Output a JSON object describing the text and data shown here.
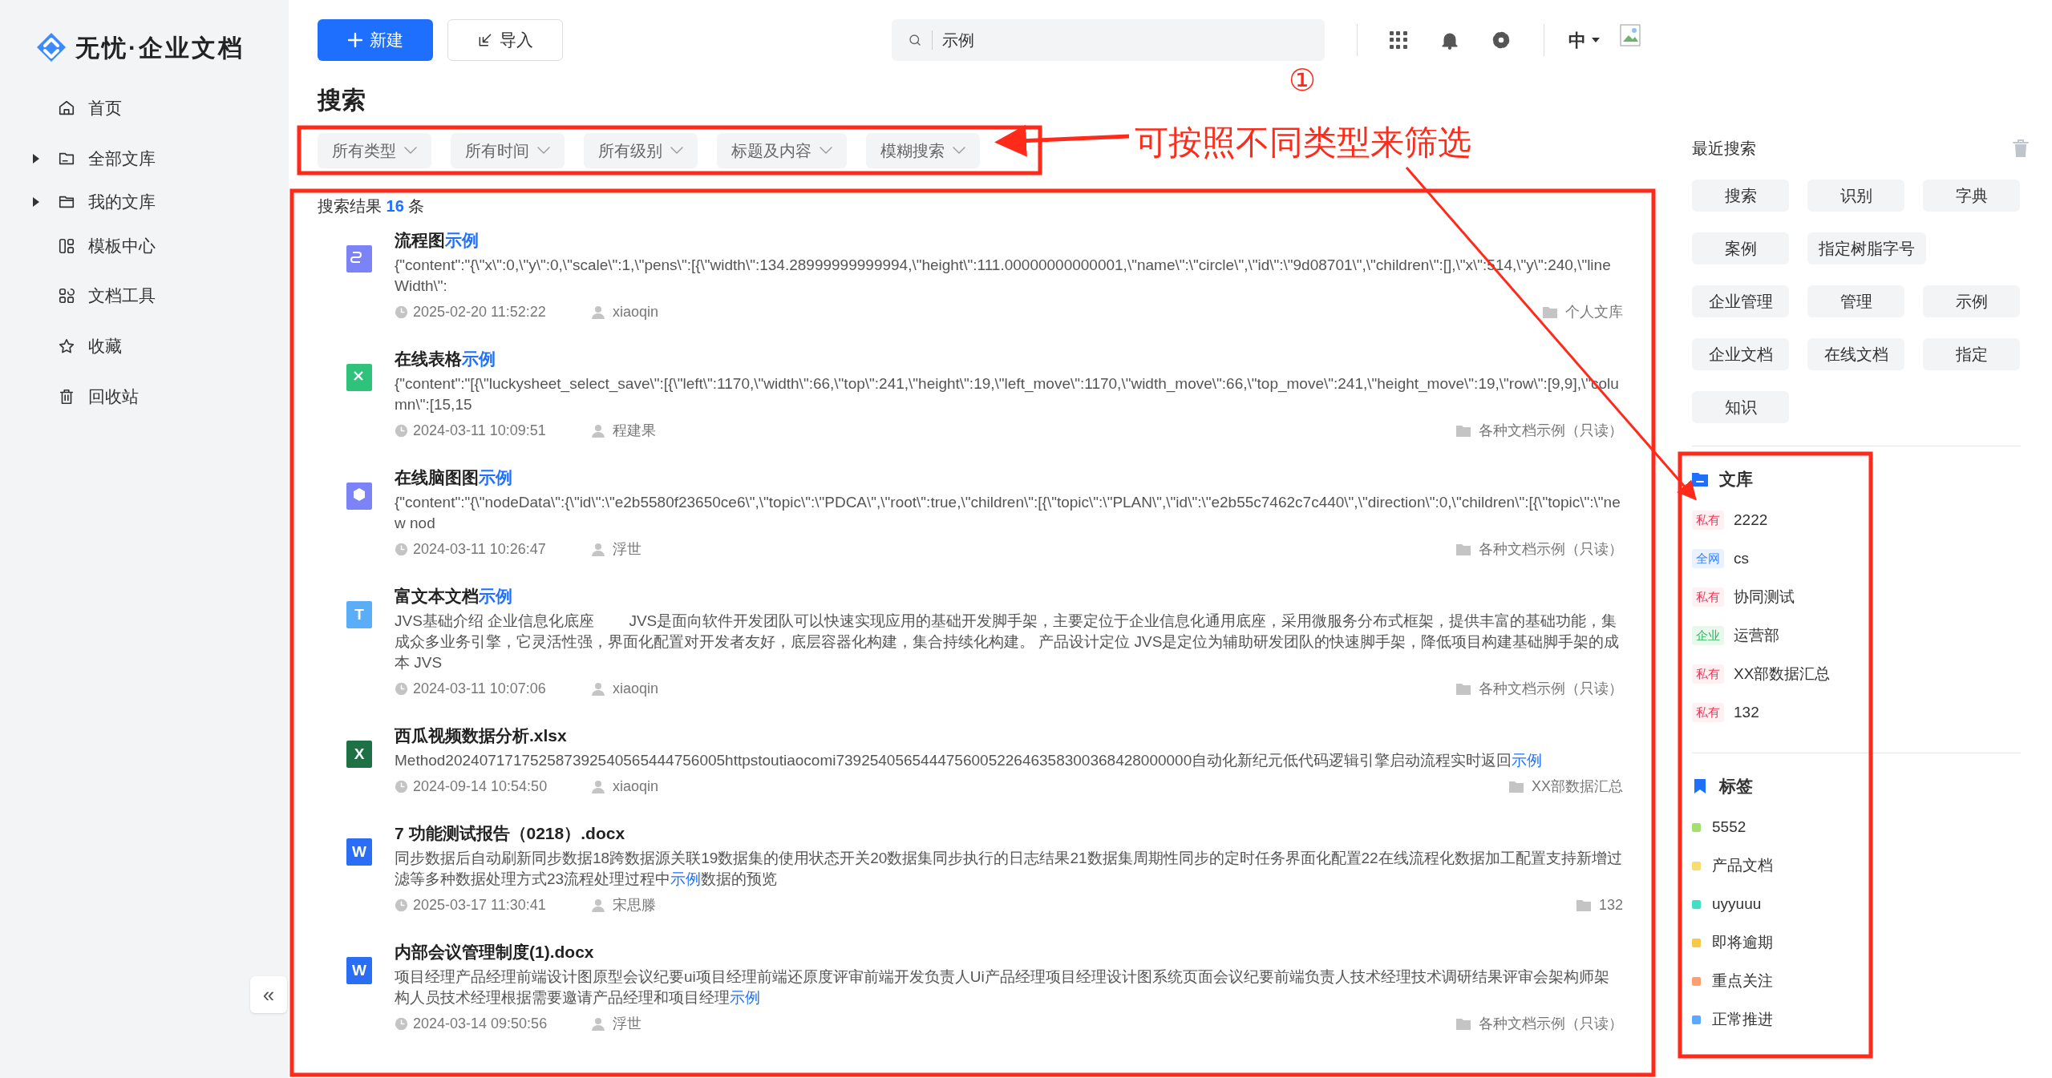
{
  "app": {
    "name": "无忧·企业文档"
  },
  "sidebar": {
    "items": [
      {
        "label": "首页",
        "expandable": false
      },
      {
        "label": "全部文库",
        "expandable": true
      },
      {
        "label": "我的文库",
        "expandable": true
      },
      {
        "label": "模板中心",
        "expandable": false
      },
      {
        "label": "文档工具",
        "expandable": false
      },
      {
        "label": "收藏",
        "expandable": false
      },
      {
        "label": "回收站",
        "expandable": false
      }
    ],
    "collapse": "«"
  },
  "toolbar": {
    "new_button": "新建",
    "import_button": "导入",
    "search": {
      "value": "示例"
    },
    "language": "中"
  },
  "page_title": "搜索",
  "filters": [
    "所有类型",
    "所有时间",
    "所有级别",
    "标题及内容",
    "模糊搜索"
  ],
  "summary": [
    {
      "text": "搜索结果 ",
      "match": false
    },
    {
      "text": "16",
      "match": true
    },
    {
      "text": " 条",
      "match": false
    }
  ],
  "results": [
    {
      "kind": "flow",
      "title": [
        {
          "text": "流程图",
          "match": false
        },
        {
          "text": "示例",
          "match": true
        }
      ],
      "content": [
        {
          "text": "{\"content\":\"{\\\"x\\\":0,\\\"y\\\":0,\\\"scale\\\":1,\\\"pens\\\":[{\\\"width\\\":134.28999999999994,\\\"height\\\":111.00000000000001,\\\"name\\\":\\\"circle\\\",\\\"id\\\":\\\"9d08701\\\",\\\"children\\\":[],\\\"x\\\":514,\\\"y\\\":240,\\\"lineWidth\\\":",
          "match": false
        }
      ],
      "time": "2025-02-20 11:52:22",
      "author": "xiaoqin",
      "library": "个人文库"
    },
    {
      "kind": "sheet",
      "title": [
        {
          "text": "在线表格",
          "match": false
        },
        {
          "text": "示例",
          "match": true
        }
      ],
      "content": [
        {
          "text": "{\"content\":\"[{\\\"luckysheet_select_save\\\":[{\\\"left\\\":1170,\\\"width\\\":66,\\\"top\\\":241,\\\"height\\\":19,\\\"left_move\\\":1170,\\\"width_move\\\":66,\\\"top_move\\\":241,\\\"height_move\\\":19,\\\"row\\\":[9,9],\\\"column\\\":[15,15",
          "match": false
        }
      ],
      "time": "2024-03-11 10:09:51",
      "author": "程建果",
      "library": "各种文档示例（只读）"
    },
    {
      "kind": "mind",
      "title": [
        {
          "text": "在线脑图图",
          "match": false
        },
        {
          "text": "示例",
          "match": true
        }
      ],
      "content": [
        {
          "text": "{\"content\":\"{\\\"nodeData\\\":{\\\"id\\\":\\\"e2b5580f23650ce6\\\",\\\"topic\\\":\\\"PDCA\\\",\\\"root\\\":true,\\\"children\\\":[{\\\"topic\\\":\\\"PLAN\\\",\\\"id\\\":\\\"e2b55c7462c7c440\\\",\\\"direction\\\":0,\\\"children\\\":[{\\\"topic\\\":\\\"new nod",
          "match": false
        }
      ],
      "time": "2024-03-11 10:26:47",
      "author": "浮世",
      "library": "各种文档示例（只读）"
    },
    {
      "kind": "text",
      "glyph": "T",
      "title": [
        {
          "text": "富文本文档",
          "match": false
        },
        {
          "text": "示例",
          "match": true
        }
      ],
      "content": [
        {
          "text": "JVS基础介绍 企业信息化底座 　　JVS是面向软件开发团队可以快速实现应用的基础开发脚手架，主要定位于企业信息化通用底座，采用微服务分布式框架，提供丰富的基础功能，集成众多业务引擎，它灵活性强，界面化配置对开发者友好，底层容器化构建，集合持续化构建。 产品设计定位 JVS是定位为辅助研发团队的快速脚手架，降低项目构建基础脚手架的成本 JVS",
          "match": false
        }
      ],
      "time": "2024-03-11 10:07:06",
      "author": "xiaoqin",
      "library": "各种文档示例（只读）"
    },
    {
      "kind": "excel",
      "glyph": "X",
      "title": [
        {
          "text": "西瓜视频数据分析.xlsx",
          "match": false
        }
      ],
      "content": [
        {
          "text": "Method2024071717525873925405654447560​05httpstoutiaocomi739254056544475600522646358300368428000000自动化新纪元低代码逻辑引擎启动流程实时返回",
          "match": false
        },
        {
          "text": "示例",
          "match": true
        }
      ],
      "time": "2024-09-14 10:54:50",
      "author": "xiaoqin",
      "library": "XX部数据汇总"
    },
    {
      "kind": "word",
      "glyph": "W",
      "title": [
        {
          "text": "7 功能测试报告（0218）.docx",
          "match": false
        }
      ],
      "content": [
        {
          "text": "同步数据后自动刷新同步数据18跨数据源关联19数据集的使用状态开关20数据集同步执行的日志结果21数据集周期性同步的定时任务界面化配置22在线流程化数据加工配置支持新增过滤等多种数据处理方式23流程处理过程中",
          "match": false
        },
        {
          "text": "示例",
          "match": true
        },
        {
          "text": "数据的预览",
          "match": false
        }
      ],
      "time": "2025-03-17 11:30:41",
      "author": "宋思滕",
      "library": "132"
    },
    {
      "kind": "word",
      "glyph": "W",
      "title": [
        {
          "text": "内部会议管理制度(1).docx",
          "match": false
        }
      ],
      "content": [
        {
          "text": "项目经理产品经理前端设计图原型会议纪要ui项目经理前端还原度评审前端开发负责人Ui产品经理项目经理设计图系统页面会议纪要前端负责人技术经理技术调研结果评审会架构师架构人员技术经理根据需要邀请产品经理和项目经理",
          "match": false
        },
        {
          "text": "示例",
          "match": true
        }
      ],
      "time": "2024-03-14 09:50:56",
      "author": "浮世",
      "library": "各种文档示例（只读）"
    }
  ],
  "recent_searches": {
    "title": "最近搜索",
    "items": [
      "搜索",
      "识别",
      "字典",
      "案例",
      "指定树脂字号",
      "企业管理",
      "管理",
      "示例",
      "企业文档",
      "在线文档",
      "指定",
      "知识"
    ]
  },
  "libraries": {
    "title": "文库",
    "items": [
      {
        "scope": "私有",
        "kind": "private",
        "name": "2222"
      },
      {
        "scope": "全网",
        "kind": "public",
        "name": "cs"
      },
      {
        "scope": "私有",
        "kind": "private",
        "name": "协同测试"
      },
      {
        "scope": "企业",
        "kind": "enterprise",
        "name": "运营部"
      },
      {
        "scope": "私有",
        "kind": "private",
        "name": "XX部数据汇总"
      },
      {
        "scope": "私有",
        "kind": "private",
        "name": "132"
      }
    ]
  },
  "tags": {
    "title": "标签",
    "items": [
      {
        "name": "5552",
        "color": "#a3e070"
      },
      {
        "name": "产品文档",
        "color": "#f7dc6f"
      },
      {
        "name": "uyyuuu",
        "color": "#3fe0c5"
      },
      {
        "name": "即将逾期",
        "color": "#f7c948"
      },
      {
        "name": "重点关注",
        "color": "#ff9f6e"
      },
      {
        "name": "正常推进",
        "color": "#5aa9ff"
      }
    ]
  },
  "annotations": {
    "callout": "可按照不同类型来筛选",
    "marker": "①"
  }
}
